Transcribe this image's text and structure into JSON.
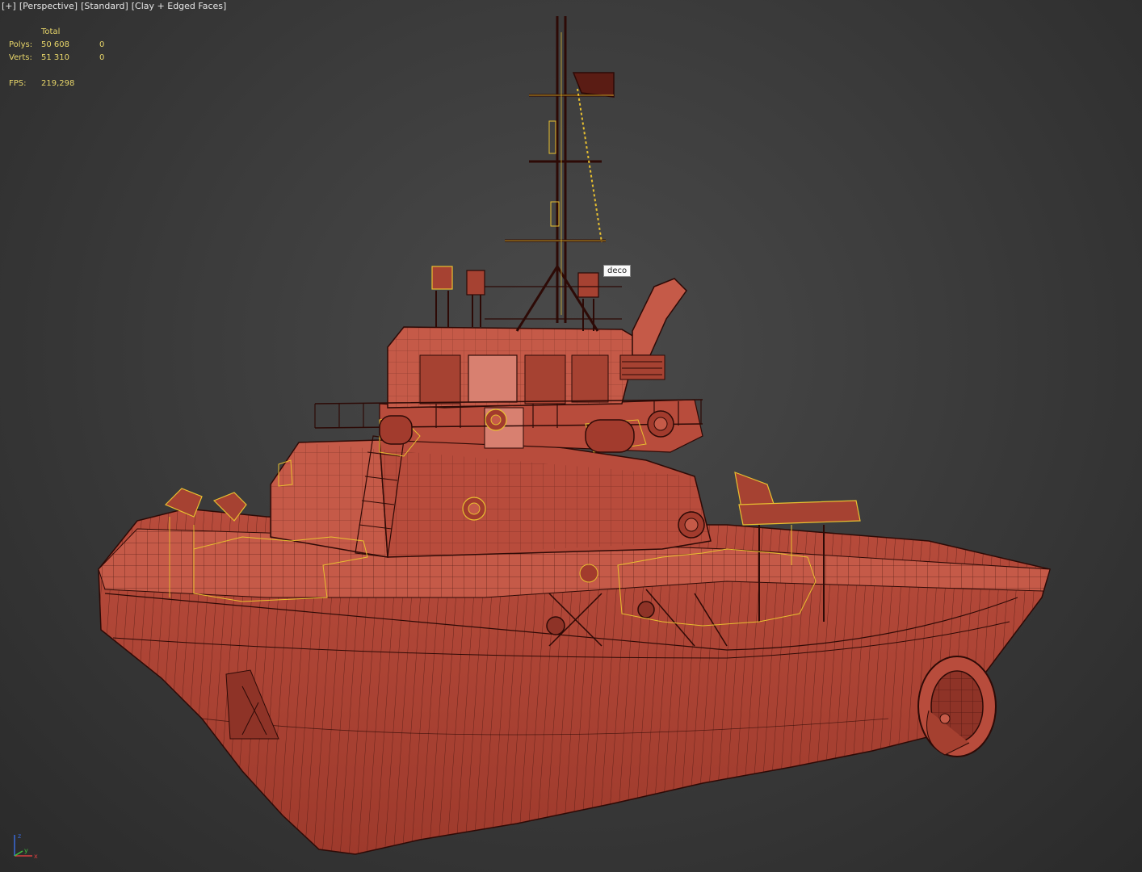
{
  "viewport": {
    "labels": [
      "[+]",
      "[Perspective]",
      "[Standard]",
      "[Clay + Edged Faces]"
    ]
  },
  "stats": {
    "header": "Total",
    "polys_label": "Polys:",
    "polys_total": "50 608",
    "polys_sel": "0",
    "verts_label": "Verts:",
    "verts_total": "51 310",
    "verts_sel": "0",
    "fps_label": "FPS:",
    "fps_value": "219,298"
  },
  "tooltip": "deco",
  "colors": {
    "clay": "#b84c3c",
    "clay_dark": "#8e3327",
    "wire": "#3a0d08",
    "selection": "#e8c030",
    "stats_text": "#e8d66a"
  },
  "gizmo": {
    "x": "x",
    "y": "y",
    "z": "z"
  }
}
